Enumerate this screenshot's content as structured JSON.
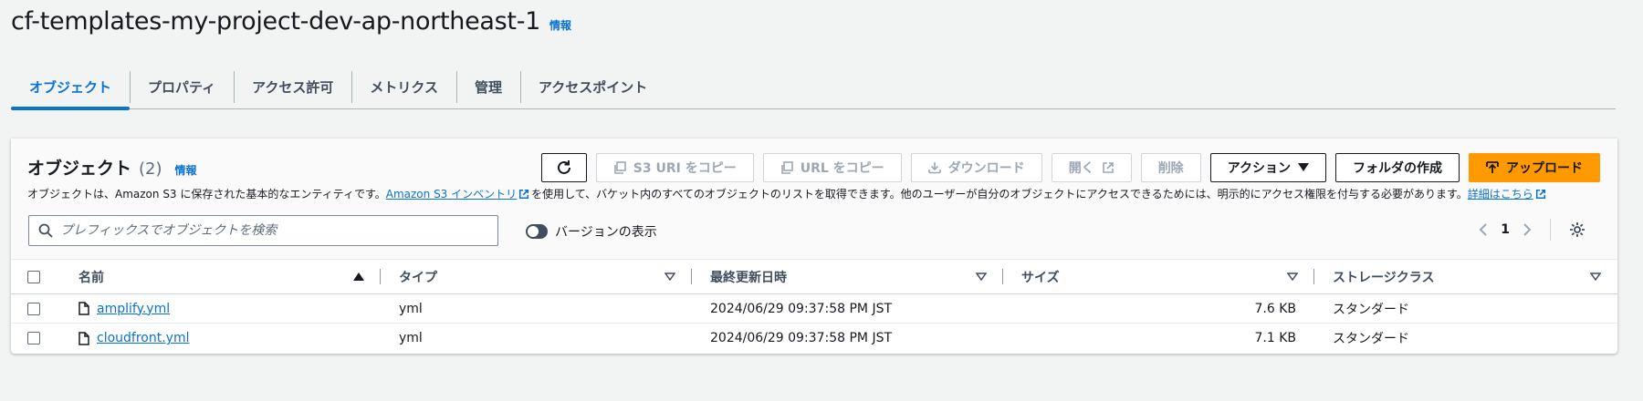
{
  "header": {
    "title": "cf-templates-my-project-dev-ap-northeast-1",
    "info": "情報"
  },
  "tabs": [
    {
      "label": "オブジェクト",
      "active": true
    },
    {
      "label": "プロパティ"
    },
    {
      "label": "アクセス許可"
    },
    {
      "label": "メトリクス"
    },
    {
      "label": "管理"
    },
    {
      "label": "アクセスポイント"
    }
  ],
  "panel": {
    "title": "オブジェクト",
    "count": "(2)",
    "info": "情報",
    "description_before": "オブジェクトは、Amazon S3 に保存された基本的なエンティティです。",
    "inventory_link": "Amazon S3 インベントリ",
    "description_middle": "を使用して、バケット内のすべてのオブジェクトのリストを取得できます。他のユーザーが自分のオブジェクトにアクセスできるためには、明示的にアクセス権限を付与する必要があります。",
    "details_link": "詳細はこちら"
  },
  "toolbar": {
    "copy_s3_uri": "S3 URI をコピー",
    "copy_url": "URL をコピー",
    "download": "ダウンロード",
    "open": "開く",
    "delete": "削除",
    "actions": "アクション",
    "create_folder": "フォルダの作成",
    "upload": "アップロード"
  },
  "search": {
    "placeholder": "プレフィックスでオブジェクトを検索"
  },
  "versions_toggle": {
    "label": "バージョンの表示"
  },
  "pagination": {
    "page": "1"
  },
  "table": {
    "columns": [
      "名前",
      "タイプ",
      "最終更新日時",
      "サイズ",
      "ストレージクラス"
    ],
    "rows": [
      {
        "name": "amplify.yml",
        "type": "yml",
        "modified": "2024/06/29 09:37:58 PM JST",
        "size": "7.6 KB",
        "storage_class": "スタンダード"
      },
      {
        "name": "cloudfront.yml",
        "type": "yml",
        "modified": "2024/06/29 09:37:58 PM JST",
        "size": "7.1 KB",
        "storage_class": "スタンダード"
      }
    ]
  },
  "colors": {
    "accent": "#0972d3",
    "primary_button": "#ff9900",
    "background": "#f2f3f3"
  }
}
